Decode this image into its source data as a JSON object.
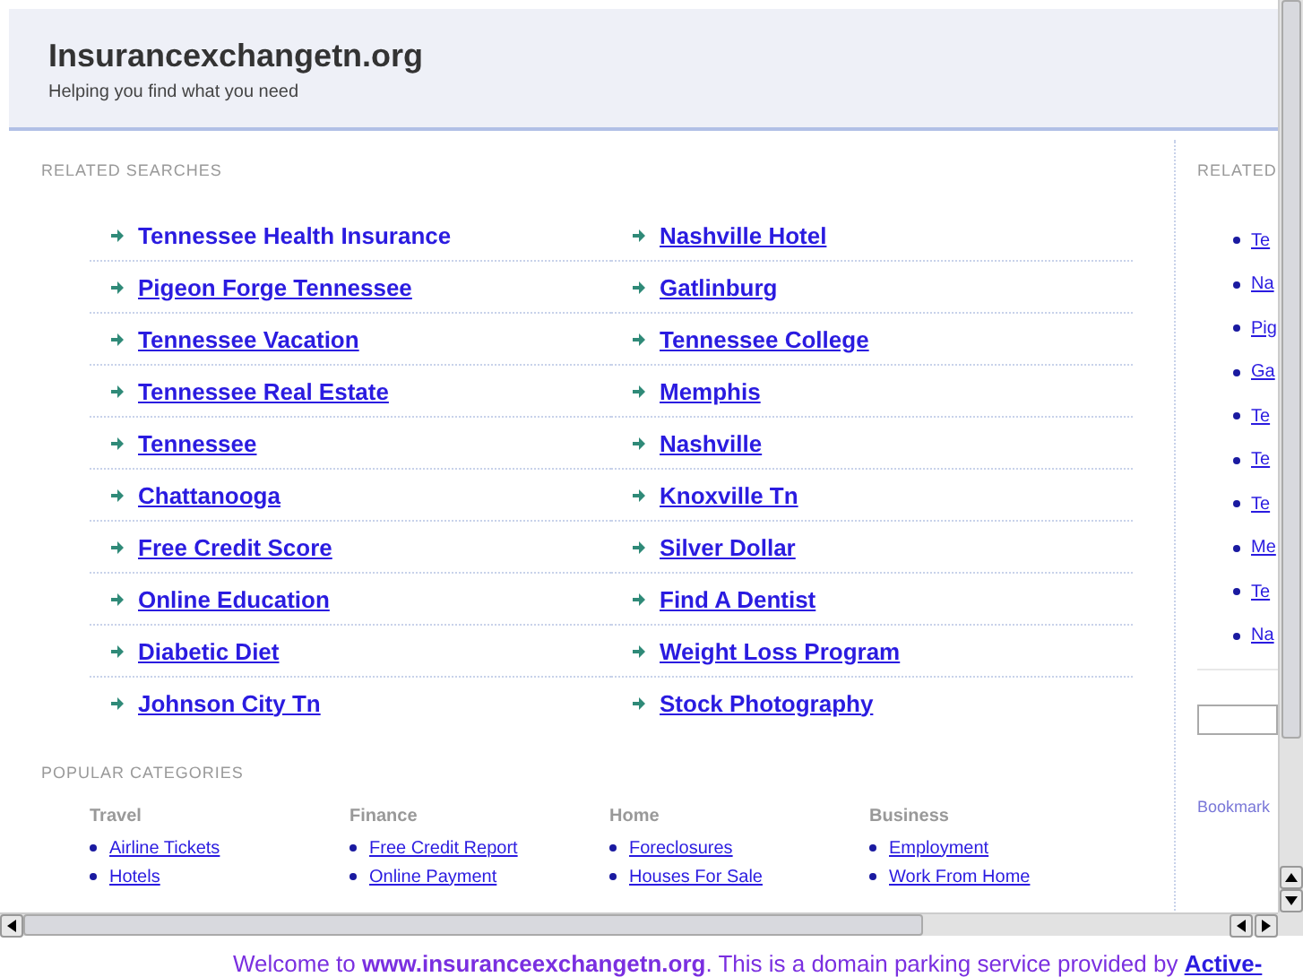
{
  "header": {
    "title": "Insurancexchangetn.org",
    "tagline": "Helping you find what you need"
  },
  "related_searches": {
    "heading": "RELATED SEARCHES",
    "links": [
      {
        "label": "Tennessee Health Insurance",
        "hovered": true
      },
      {
        "label": "Nashville Hotel",
        "hovered": false
      },
      {
        "label": "Pigeon Forge Tennessee",
        "hovered": false
      },
      {
        "label": "Gatlinburg",
        "hovered": false
      },
      {
        "label": "Tennessee Vacation",
        "hovered": false
      },
      {
        "label": "Tennessee College",
        "hovered": false
      },
      {
        "label": "Tennessee Real Estate",
        "hovered": false
      },
      {
        "label": "Memphis",
        "hovered": false
      },
      {
        "label": "Tennessee",
        "hovered": false
      },
      {
        "label": "Nashville",
        "hovered": false
      },
      {
        "label": "Chattanooga",
        "hovered": false
      },
      {
        "label": "Knoxville Tn",
        "hovered": false
      },
      {
        "label": "Free Credit Score",
        "hovered": false
      },
      {
        "label": "Silver Dollar",
        "hovered": false
      },
      {
        "label": "Online Education",
        "hovered": false
      },
      {
        "label": "Find A Dentist",
        "hovered": false
      },
      {
        "label": "Diabetic Diet",
        "hovered": false
      },
      {
        "label": "Weight Loss Program",
        "hovered": false
      },
      {
        "label": "Johnson City Tn",
        "hovered": false
      },
      {
        "label": "Stock Photography",
        "hovered": false
      }
    ]
  },
  "popular_categories": {
    "heading": "POPULAR CATEGORIES",
    "groups": [
      {
        "title": "Travel",
        "links": [
          "Airline Tickets",
          "Hotels"
        ]
      },
      {
        "title": "Finance",
        "links": [
          "Free Credit Report",
          "Online Payment"
        ]
      },
      {
        "title": "Home",
        "links": [
          "Foreclosures",
          "Houses For Sale"
        ]
      },
      {
        "title": "Business",
        "links": [
          "Employment",
          "Work From Home"
        ]
      }
    ]
  },
  "sidebar": {
    "heading": "RELATED",
    "links": [
      "Te",
      "Na",
      "Pig",
      "Ga",
      "Te",
      "Te",
      "Te",
      "Me",
      "Te",
      "Na"
    ],
    "bookmark": "Bookmark"
  },
  "footer": {
    "text": "Welcome to **www.insuranceexchangetn.org**. This is a domain parking service provided by ",
    "link": "Active-"
  }
}
